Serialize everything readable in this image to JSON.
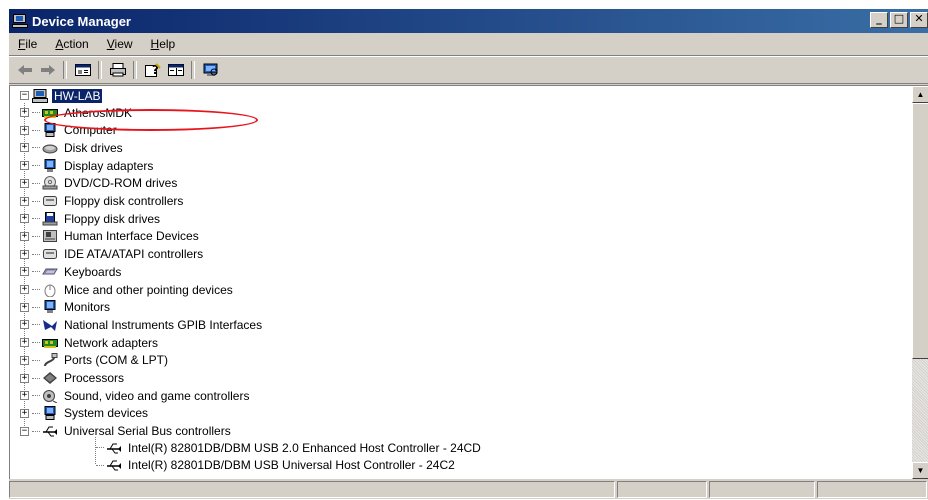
{
  "window": {
    "title": "Device Manager"
  },
  "menu": [
    {
      "label": "File",
      "u": "F",
      "rest": "ile"
    },
    {
      "label": "Action",
      "u": "A",
      "rest": "ction"
    },
    {
      "label": "View",
      "u": "V",
      "rest": "iew"
    },
    {
      "label": "Help",
      "u": "H",
      "rest": "elp"
    }
  ],
  "toolbar": {
    "buttons": [
      "back-arrow-icon",
      "forward-arrow-icon",
      "properties-icon",
      "print-icon",
      "help-icon",
      "show-hide-icon",
      "scan-hardware-icon"
    ]
  },
  "tree": {
    "root": "HW-LAB",
    "categories": [
      {
        "label": "AtherosMDK",
        "icon": "network-card-icon"
      },
      {
        "label": "Computer",
        "icon": "computer-icon"
      },
      {
        "label": "Disk drives",
        "icon": "disk-drive-icon"
      },
      {
        "label": "Display adapters",
        "icon": "display-adapter-icon"
      },
      {
        "label": "DVD/CD-ROM drives",
        "icon": "cdrom-icon"
      },
      {
        "label": "Floppy disk controllers",
        "icon": "disk-controller-icon"
      },
      {
        "label": "Floppy disk drives",
        "icon": "floppy-drive-icon"
      },
      {
        "label": "Human Interface Devices",
        "icon": "hid-icon"
      },
      {
        "label": "IDE ATA/ATAPI controllers",
        "icon": "ide-controller-icon"
      },
      {
        "label": "Keyboards",
        "icon": "keyboard-icon"
      },
      {
        "label": "Mice and other pointing devices",
        "icon": "mouse-icon"
      },
      {
        "label": "Monitors",
        "icon": "monitor-icon"
      },
      {
        "label": "National Instruments GPIB Interfaces",
        "icon": "gpib-icon"
      },
      {
        "label": "Network adapters",
        "icon": "network-adapter-icon"
      },
      {
        "label": "Ports (COM & LPT)",
        "icon": "port-icon"
      },
      {
        "label": "Processors",
        "icon": "processor-icon"
      },
      {
        "label": "Sound, video and game controllers",
        "icon": "sound-icon"
      },
      {
        "label": "System devices",
        "icon": "system-device-icon"
      },
      {
        "label": "Universal Serial Bus controllers",
        "icon": "usb-icon"
      }
    ],
    "usb_children": [
      "Intel(R) 82801DB/DBM USB 2.0 Enhanced Host Controller - 24CD",
      "Intel(R) 82801DB/DBM USB Universal Host Controller - 24C2"
    ]
  },
  "colors": {
    "titlebar": "#0a246a",
    "selection": "#0a246a",
    "annotation": "#e8141c"
  }
}
